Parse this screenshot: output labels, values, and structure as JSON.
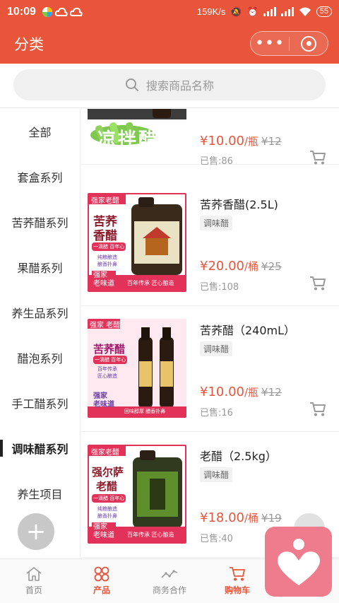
{
  "status": {
    "time": "10:09",
    "speed": "159K/s",
    "battery": "55"
  },
  "header": {
    "title": "分类",
    "more_label": "•••"
  },
  "search": {
    "placeholder": "搜索商品名称"
  },
  "sidebar": {
    "active_index": 7,
    "items": [
      {
        "label": "全部"
      },
      {
        "label": "套盒系列"
      },
      {
        "label": "苦荞醋系列"
      },
      {
        "label": "果醋系列"
      },
      {
        "label": "养生品系列"
      },
      {
        "label": "醋泡系列"
      },
      {
        "label": "手工醋系列"
      },
      {
        "label": "调味醋系列"
      },
      {
        "label": "养生项目"
      }
    ],
    "add_label": "+"
  },
  "products": [
    {
      "name": "",
      "tag": "",
      "price": "¥10.00",
      "unit": "/瓶",
      "orig_price": "¥12",
      "sold": "已售:86",
      "image_text": "凉拌醋",
      "image_label": "凉拌醋"
    },
    {
      "name": "苦荞香醋(2.5L)",
      "tag": "调味醋",
      "price": "¥20.00",
      "unit": "/桶",
      "orig_price": "¥25",
      "sold": "已售:108",
      "image_badge": "强家老醋",
      "image_title_1": "苦荞",
      "image_title_2": "香醋",
      "image_sub": "一滴醋 百年心",
      "image_points": [
        "纯粮酿造",
        "酿香扑鼻"
      ],
      "image_brand": "强家\n老味道",
      "image_slogan": "百年传承  匠心酿造"
    },
    {
      "name": "苦荞醋（240mL）",
      "tag": "调味醋",
      "price": "¥10.00",
      "unit": "/瓶",
      "orig_price": "¥12",
      "sold": "已售:16",
      "image_badge": "强家 老醋",
      "image_title_1": "苦荞醋",
      "image_sub": "一滴醋 百年心",
      "image_points": [
        "百年传承",
        "匠心酿造"
      ],
      "image_brand": "强家\n老味道",
      "image_slogan": "回味醇厚  醋香扑鼻"
    },
    {
      "name": "老醋（2.5kg）",
      "tag": "调味醋",
      "price": "¥18.00",
      "unit": "/桶",
      "orig_price": "¥19",
      "sold": "已售:40",
      "image_badge": "强家老醋",
      "image_title_1": "强尔萨",
      "image_title_2": "老醋",
      "image_sub": "一滴醋 百年心",
      "image_points": [
        "纯粮酿造",
        "酿香扑鼻"
      ],
      "image_brand": "强家\n老味道",
      "image_slogan": "百年传承  匠心酿造"
    }
  ],
  "bottom_nav": [
    {
      "label": "首页",
      "icon": "home-icon"
    },
    {
      "label": "产品",
      "icon": "grid-icon"
    },
    {
      "label": "商务合作",
      "icon": "trend-icon"
    },
    {
      "label": "购物车",
      "icon": "cart-icon"
    },
    {
      "label": "",
      "icon": ""
    }
  ],
  "colors": {
    "brand": "#e8553b",
    "accent_pink": "#ef7c8c"
  }
}
